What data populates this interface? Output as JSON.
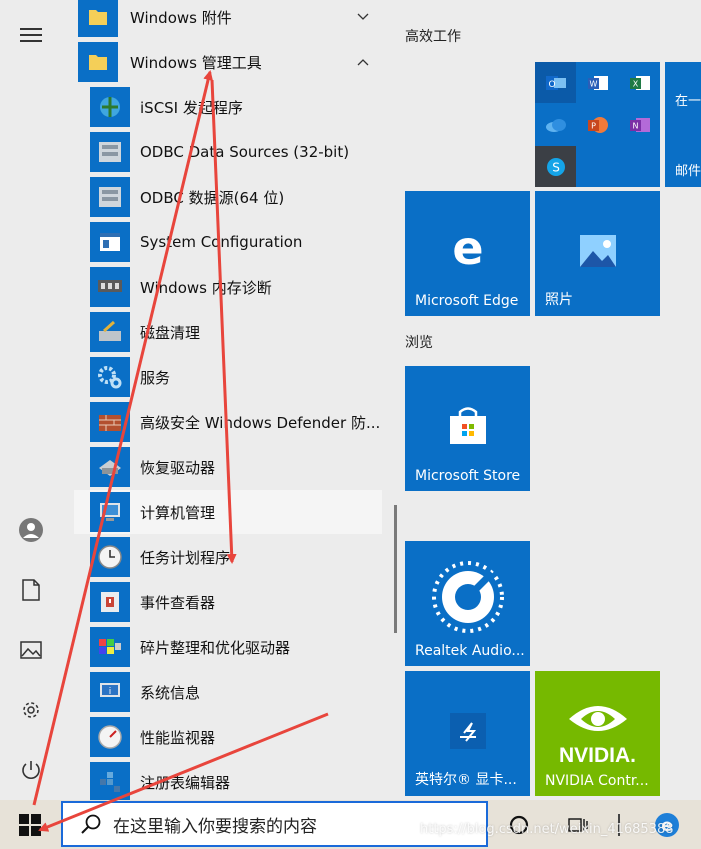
{
  "folders": [
    {
      "label": "Windows 附件",
      "expanded": false
    },
    {
      "label": "Windows 管理工具",
      "expanded": true
    }
  ],
  "apps": [
    {
      "label": "iSCSI 发起程序",
      "icon": "iscsi-icon"
    },
    {
      "label": "ODBC Data Sources (32-bit)",
      "icon": "odbc-icon"
    },
    {
      "label": "ODBC 数据源(64 位)",
      "icon": "odbc-icon"
    },
    {
      "label": "System Configuration",
      "icon": "system-config-icon"
    },
    {
      "label": "Windows 内存诊断",
      "icon": "memory-diagnostic-icon"
    },
    {
      "label": "磁盘清理",
      "icon": "disk-cleanup-icon"
    },
    {
      "label": "服务",
      "icon": "services-gear-icon"
    },
    {
      "label": "高级安全 Windows Defender 防...",
      "icon": "firewall-icon"
    },
    {
      "label": "恢复驱动器",
      "icon": "recovery-drive-icon"
    },
    {
      "label": "计算机管理",
      "icon": "computer-management-icon"
    },
    {
      "label": "任务计划程序",
      "icon": "task-scheduler-clock-icon"
    },
    {
      "label": "事件查看器",
      "icon": "event-viewer-icon"
    },
    {
      "label": "碎片整理和优化驱动器",
      "icon": "defrag-icon"
    },
    {
      "label": "系统信息",
      "icon": "system-info-icon"
    },
    {
      "label": "性能监视器",
      "icon": "performance-monitor-icon"
    },
    {
      "label": "注册表编辑器",
      "icon": "registry-editor-icon"
    }
  ],
  "groups": {
    "productivity": "高效工作",
    "browse": "浏览"
  },
  "tiles": {
    "mail_partial_top": "在一",
    "mail_partial_bottom": "邮件",
    "edge": "Microsoft Edge",
    "photos": "照片",
    "store": "Microsoft Store",
    "realtek": "Realtek Audio...",
    "intel": "英特尔® 显卡...",
    "nvidia": "NVIDIA Contr...",
    "nvidia_logo": "NVIDIA."
  },
  "taskbar": {
    "search_placeholder": "在这里输入你要搜索的内容",
    "watermark": "https://blog.csdn.net/weixin_41685388"
  },
  "colors": {
    "tile_blue": "#0a6fc6",
    "nvidia_green": "#76b900",
    "arrow_red": "#e8453c",
    "search_border": "#1a6ad9"
  }
}
